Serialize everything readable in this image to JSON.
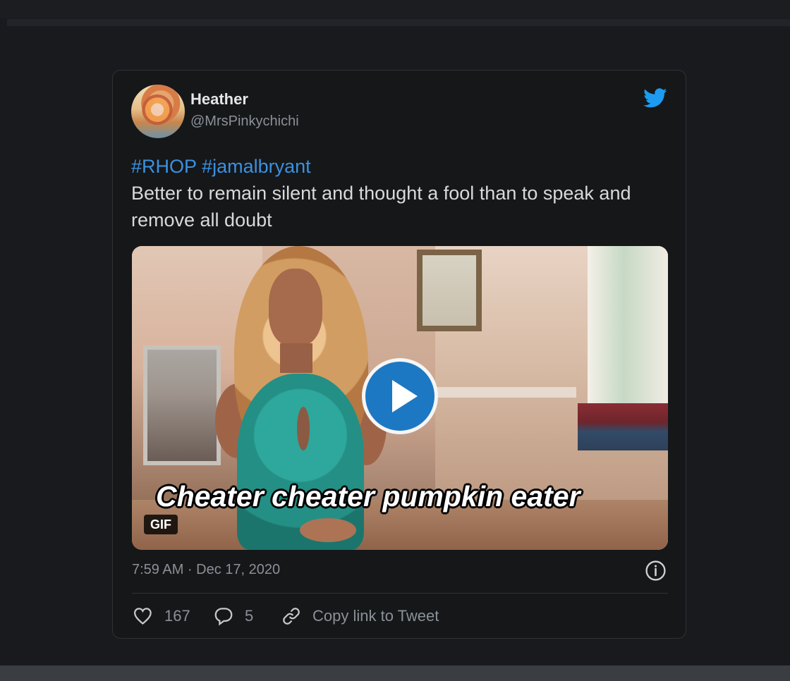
{
  "tweet": {
    "author": {
      "name": "Heather",
      "handle": "@MrsPinkychichi"
    },
    "hashtags": [
      "#RHOP",
      "#jamalbryant"
    ],
    "text": "Better to remain silent and thought a fool than to speak and remove all doubt",
    "media": {
      "caption": "Cheater cheater pumpkin eater",
      "badge": "GIF"
    },
    "timestamp": "7:59 AM · Dec 17, 2020",
    "actions": {
      "like_count": "167",
      "reply_count": "5",
      "copy_link_label": "Copy link to Tweet"
    }
  },
  "icons": {
    "brand": "twitter-bird-icon",
    "play": "play-icon",
    "info": "info-icon",
    "like": "heart-icon",
    "reply": "comment-icon",
    "copy": "link-icon"
  },
  "colors": {
    "background": "#181a1e",
    "card": "#151719",
    "accent": "#1d9bf0",
    "hashtag": "#3b91df",
    "text": "#d9d9d9",
    "muted": "#8b9198"
  }
}
